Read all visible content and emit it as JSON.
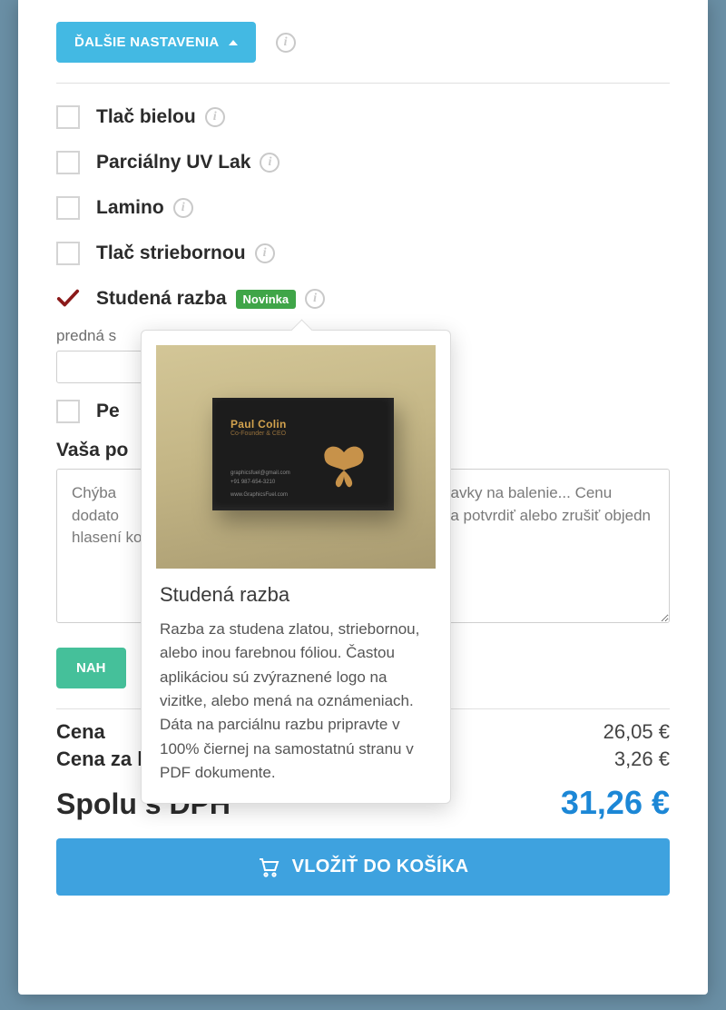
{
  "header": {
    "settings_button": "ĎALŠIE NASTAVENIA"
  },
  "options": [
    {
      "label": "Tlač bielou",
      "checked": false,
      "badge": null
    },
    {
      "label": "Parciálny UV Lak",
      "checked": false,
      "badge": null
    },
    {
      "label": "Lamino",
      "checked": false,
      "badge": null
    },
    {
      "label": "Tlač striebornou",
      "checked": false,
      "badge": null
    },
    {
      "label": "Studená razba",
      "checked": true,
      "badge": "Novinka"
    }
  ],
  "upload_section": {
    "front_label": "predná s",
    "pe_label": "Pe"
  },
  "note": {
    "label": "Vaša po",
    "value": "Chýba                                                                              avky na balenie... Cenu dodato                                                                           ť a potvrdiť alebo zrušiť objedn                                                                            hlasení konečnej ceny."
  },
  "upload_button": "NAH",
  "summary": {
    "price_label": "Cena",
    "price_value": "26,05 €",
    "per_piece_label": "Cena za kus",
    "per_piece_value": "3,26 €",
    "total_label": "Spolu s DPH",
    "total_value": "31,26 €"
  },
  "cart_button": "VLOŽIŤ DO KOŠÍKA",
  "popover": {
    "title": "Studená razba",
    "text": "Razba za studena zlatou, striebornou, alebo inou farebnou fóliou. Častou aplikáciou sú zvýraznené logo na vizitke, alebo mená na oznámeniach. Dáta na parciálnu razbu pripravte v 100% čiernej na samostatnú stranu v PDF dokumente.",
    "card": {
      "name": "Paul Colin",
      "subtitle": "Co-Founder & CEO",
      "line1": "graphicsfuel@gmail.com",
      "line2": "+91 987-654-3210",
      "line3": "www.GraphicsFuel.com"
    }
  }
}
